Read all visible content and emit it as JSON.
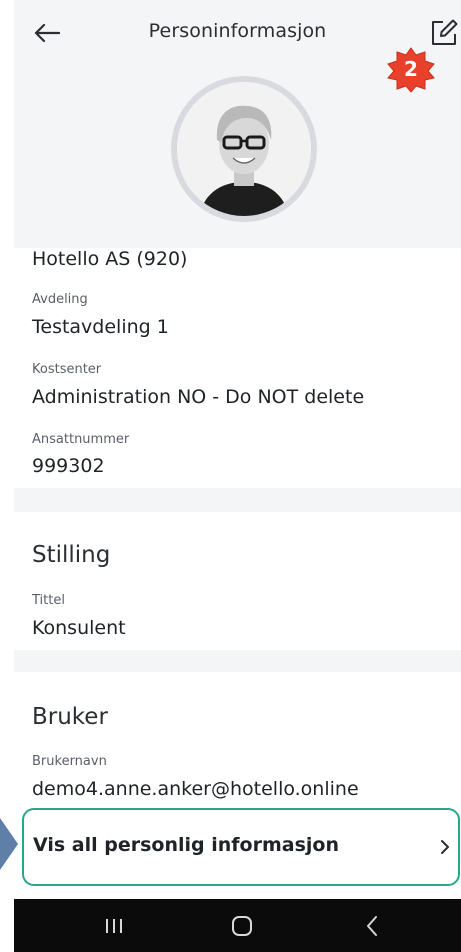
{
  "header": {
    "title": "Personinformasjon",
    "badge_number": "2",
    "badge_color": "#e8402a"
  },
  "organisation": {
    "company": "Hotello AS (920)",
    "department_label": "Avdeling",
    "department_value": "Testavdeling 1",
    "cost_center_label": "Kostsenter",
    "cost_center_value": "Administration NO - Do NOT delete",
    "employee_number_label": "Ansattnummer",
    "employee_number_value": "999302"
  },
  "position": {
    "section_title": "Stilling",
    "title_label": "Tittel",
    "title_value": "Konsulent"
  },
  "user": {
    "section_title": "Bruker",
    "username_label": "Brukernavn",
    "username_value": "demo4.anne.anker@hotello.online"
  },
  "show_all": {
    "label": "Vis all personlig informasjon",
    "highlight_color": "#2aa58a"
  },
  "icons": {
    "back": "arrow-left-icon",
    "edit": "edit-icon",
    "chevron": "chevron-right-icon",
    "nav_recents": "recents-icon",
    "nav_home": "home-icon",
    "nav_back": "nav-back-icon"
  }
}
